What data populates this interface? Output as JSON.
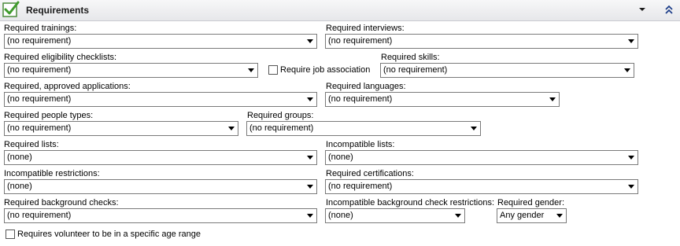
{
  "header": {
    "title": "Requirements",
    "icons": {
      "check": "checkmark-icon",
      "dropdown": "chevron-down-icon",
      "collapse": "double-chevron-up-icon"
    }
  },
  "fields": {
    "trainings": {
      "label": "Required trainings:",
      "value": "(no requirement)"
    },
    "interviews": {
      "label": "Required interviews:",
      "value": "(no requirement)"
    },
    "eligibility": {
      "label": "Required eligibility checklists:",
      "value": "(no requirement)"
    },
    "job_association": {
      "label": "Require job association"
    },
    "skills": {
      "label": "Required skills:",
      "value": "(no requirement)"
    },
    "applications": {
      "label": "Required, approved applications:",
      "value": "(no requirement)"
    },
    "languages": {
      "label": "Required languages:",
      "value": "(no requirement)"
    },
    "people_types": {
      "label": "Required people types:",
      "value": "(no requirement)"
    },
    "groups": {
      "label": "Required groups:",
      "value": "(no requirement)"
    },
    "lists": {
      "label": "Required lists:",
      "value": "(none)"
    },
    "incompatible_lists": {
      "label": "Incompatible lists:",
      "value": "(none)"
    },
    "incompatible_restrictions": {
      "label": "Incompatible restrictions:",
      "value": "(none)"
    },
    "certifications": {
      "label": "Required certifications:",
      "value": "(no requirement)"
    },
    "background_checks": {
      "label": "Required background checks:",
      "value": "(no requirement)"
    },
    "incompatible_bg_restrictions": {
      "label": "Incompatible background check restrictions:",
      "value": "(none)"
    },
    "gender": {
      "label": "Required gender:",
      "value": "Any gender"
    },
    "age_range": {
      "label": "Requires volunteer to be in a specific age range"
    }
  }
}
